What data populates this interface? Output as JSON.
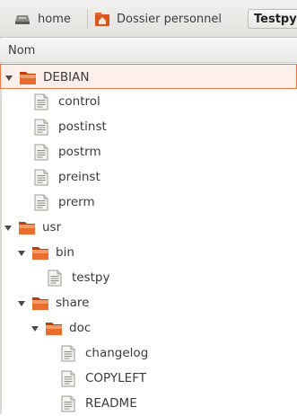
{
  "breadcrumb": {
    "home": "home",
    "personal": "Dossier personnel",
    "current": "Testpy"
  },
  "column_header": "Nom",
  "selected_color": "#f07746",
  "tree": [
    {
      "label": "DEBIAN",
      "type": "folder",
      "expanded": true,
      "level": 0,
      "selected": true
    },
    {
      "label": "control",
      "type": "file",
      "level": 1
    },
    {
      "label": "postinst",
      "type": "file",
      "level": 1
    },
    {
      "label": "postrm",
      "type": "file",
      "level": 1
    },
    {
      "label": "preinst",
      "type": "file",
      "level": 1
    },
    {
      "label": "prerm",
      "type": "file",
      "level": 1
    },
    {
      "label": "usr",
      "type": "folder",
      "expanded": true,
      "level": 0
    },
    {
      "label": "bin",
      "type": "folder",
      "expanded": true,
      "level": 1
    },
    {
      "label": "testpy",
      "type": "file",
      "level": 2
    },
    {
      "label": "share",
      "type": "folder",
      "expanded": true,
      "level": 1
    },
    {
      "label": "doc",
      "type": "folder",
      "expanded": true,
      "level": 2
    },
    {
      "label": "changelog",
      "type": "file",
      "level": 3
    },
    {
      "label": "COPYLEFT",
      "type": "file",
      "level": 3
    },
    {
      "label": "README",
      "type": "file",
      "level": 3
    }
  ]
}
